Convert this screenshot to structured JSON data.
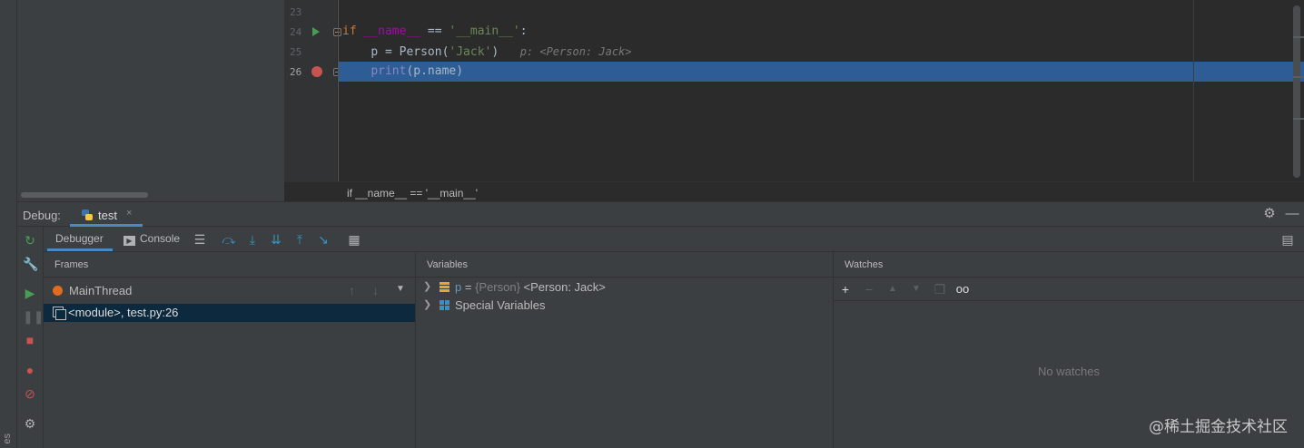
{
  "left_strip": {
    "vertical_label": "es"
  },
  "editor": {
    "lines": [
      {
        "number": "23"
      },
      {
        "number": "24",
        "tokens": [
          "if",
          " ",
          "__name__",
          " == ",
          "'__main__'",
          ":"
        ]
      },
      {
        "number": "25",
        "tokens": [
          "p = Person(",
          "'Jack'",
          ")"
        ],
        "inline_hint": "p: <Person: Jack>"
      },
      {
        "number": "26",
        "tokens": [
          "print",
          "(p.name)"
        ]
      }
    ],
    "breadcrumb": "if __name__ == '__main__'"
  },
  "debug_header": {
    "label": "Debug:",
    "tab_name": "test",
    "tab_close": "×"
  },
  "debug_toolbar": {
    "debugger_tab": "Debugger",
    "console_tab": "Console"
  },
  "frames": {
    "title": "Frames",
    "thread_name": "MainThread",
    "frame_label": "<module>, test.py:26"
  },
  "variables": {
    "title": "Variables",
    "items": [
      {
        "name": "p",
        "eq": " = ",
        "type": "{Person}",
        "value": " <Person: Jack>"
      },
      {
        "label": "Special Variables"
      }
    ]
  },
  "watches": {
    "title": "Watches",
    "empty_text": "No watches"
  },
  "watermark": "@稀土掘金技术社区",
  "colors": {
    "selection": "#2d5d94",
    "breakpoint": "#c75450",
    "run": "#499c54",
    "accent": "#4a88c7"
  }
}
